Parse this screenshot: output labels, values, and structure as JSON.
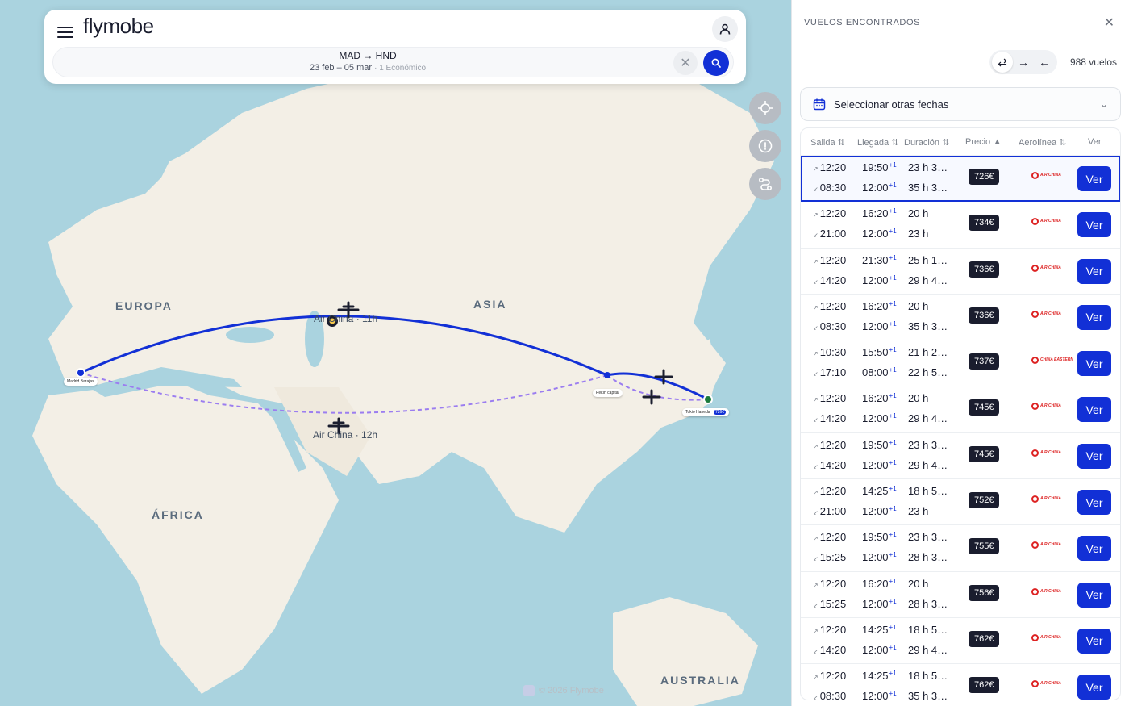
{
  "app": {
    "brand": "flymobe"
  },
  "search": {
    "route": "MAD → HND",
    "dates": "23 feb – 05 mar",
    "passengers": "· 1 Económico"
  },
  "map": {
    "regions": {
      "europe": "EUROPA",
      "asia": "ASIA",
      "africa": "ÁFRICA",
      "australia": "AUSTRALIA"
    },
    "airports": {
      "origin": "Madrid Barajas",
      "hub": "Pekín capital",
      "destination": "Tokio Haneda",
      "destination_price": "726€"
    },
    "routes": {
      "outbound": "Air China · 11h",
      "return": "Air China · 12h"
    },
    "copyright": "© 2026 Flymobe"
  },
  "panel": {
    "title": "VUELOS ENCONTRADOS",
    "count": "988 vuelos",
    "date_selector": "Seleccionar otras fechas",
    "headers": {
      "salida": "Salida",
      "llegada": "Llegada",
      "duracion": "Duración",
      "precio": "Precio",
      "aerolinea": "Aerolínea",
      "ver": "Ver"
    },
    "ver_label": "Ver",
    "flights": [
      {
        "dep1": "12:20",
        "arr1": "19:50",
        "dur1": "23 h 3…",
        "dep2": "08:30",
        "arr2": "12:00",
        "dur2": "35 h 3…",
        "price": "726€",
        "airline": "AIR CHINA"
      },
      {
        "dep1": "12:20",
        "arr1": "16:20",
        "dur1": "20 h",
        "dep2": "21:00",
        "arr2": "12:00",
        "dur2": "23 h",
        "price": "734€",
        "airline": "AIR CHINA"
      },
      {
        "dep1": "12:20",
        "arr1": "21:30",
        "dur1": "25 h 1…",
        "dep2": "14:20",
        "arr2": "12:00",
        "dur2": "29 h 4…",
        "price": "736€",
        "airline": "AIR CHINA"
      },
      {
        "dep1": "12:20",
        "arr1": "16:20",
        "dur1": "20 h",
        "dep2": "08:30",
        "arr2": "12:00",
        "dur2": "35 h 3…",
        "price": "736€",
        "airline": "AIR CHINA"
      },
      {
        "dep1": "10:30",
        "arr1": "15:50",
        "dur1": "21 h 2…",
        "dep2": "17:10",
        "arr2": "08:00",
        "dur2": "22 h 5…",
        "price": "737€",
        "airline": "CHINA EASTERN"
      },
      {
        "dep1": "12:20",
        "arr1": "16:20",
        "dur1": "20 h",
        "dep2": "14:20",
        "arr2": "12:00",
        "dur2": "29 h 4…",
        "price": "745€",
        "airline": "AIR CHINA"
      },
      {
        "dep1": "12:20",
        "arr1": "19:50",
        "dur1": "23 h 3…",
        "dep2": "14:20",
        "arr2": "12:00",
        "dur2": "29 h 4…",
        "price": "745€",
        "airline": "AIR CHINA"
      },
      {
        "dep1": "12:20",
        "arr1": "14:25",
        "dur1": "18 h 5…",
        "dep2": "21:00",
        "arr2": "12:00",
        "dur2": "23 h",
        "price": "752€",
        "airline": "AIR CHINA"
      },
      {
        "dep1": "12:20",
        "arr1": "19:50",
        "dur1": "23 h 3…",
        "dep2": "15:25",
        "arr2": "12:00",
        "dur2": "28 h 3…",
        "price": "755€",
        "airline": "AIR CHINA"
      },
      {
        "dep1": "12:20",
        "arr1": "16:20",
        "dur1": "20 h",
        "dep2": "15:25",
        "arr2": "12:00",
        "dur2": "28 h 3…",
        "price": "756€",
        "airline": "AIR CHINA"
      },
      {
        "dep1": "12:20",
        "arr1": "14:25",
        "dur1": "18 h 5…",
        "dep2": "14:20",
        "arr2": "12:00",
        "dur2": "29 h 4…",
        "price": "762€",
        "airline": "AIR CHINA"
      },
      {
        "dep1": "12:20",
        "arr1": "14:25",
        "dur1": "18 h 5…",
        "dep2": "08:30",
        "arr2": "12:00",
        "dur2": "35 h 3…",
        "price": "762€",
        "airline": "AIR CHINA"
      }
    ]
  }
}
